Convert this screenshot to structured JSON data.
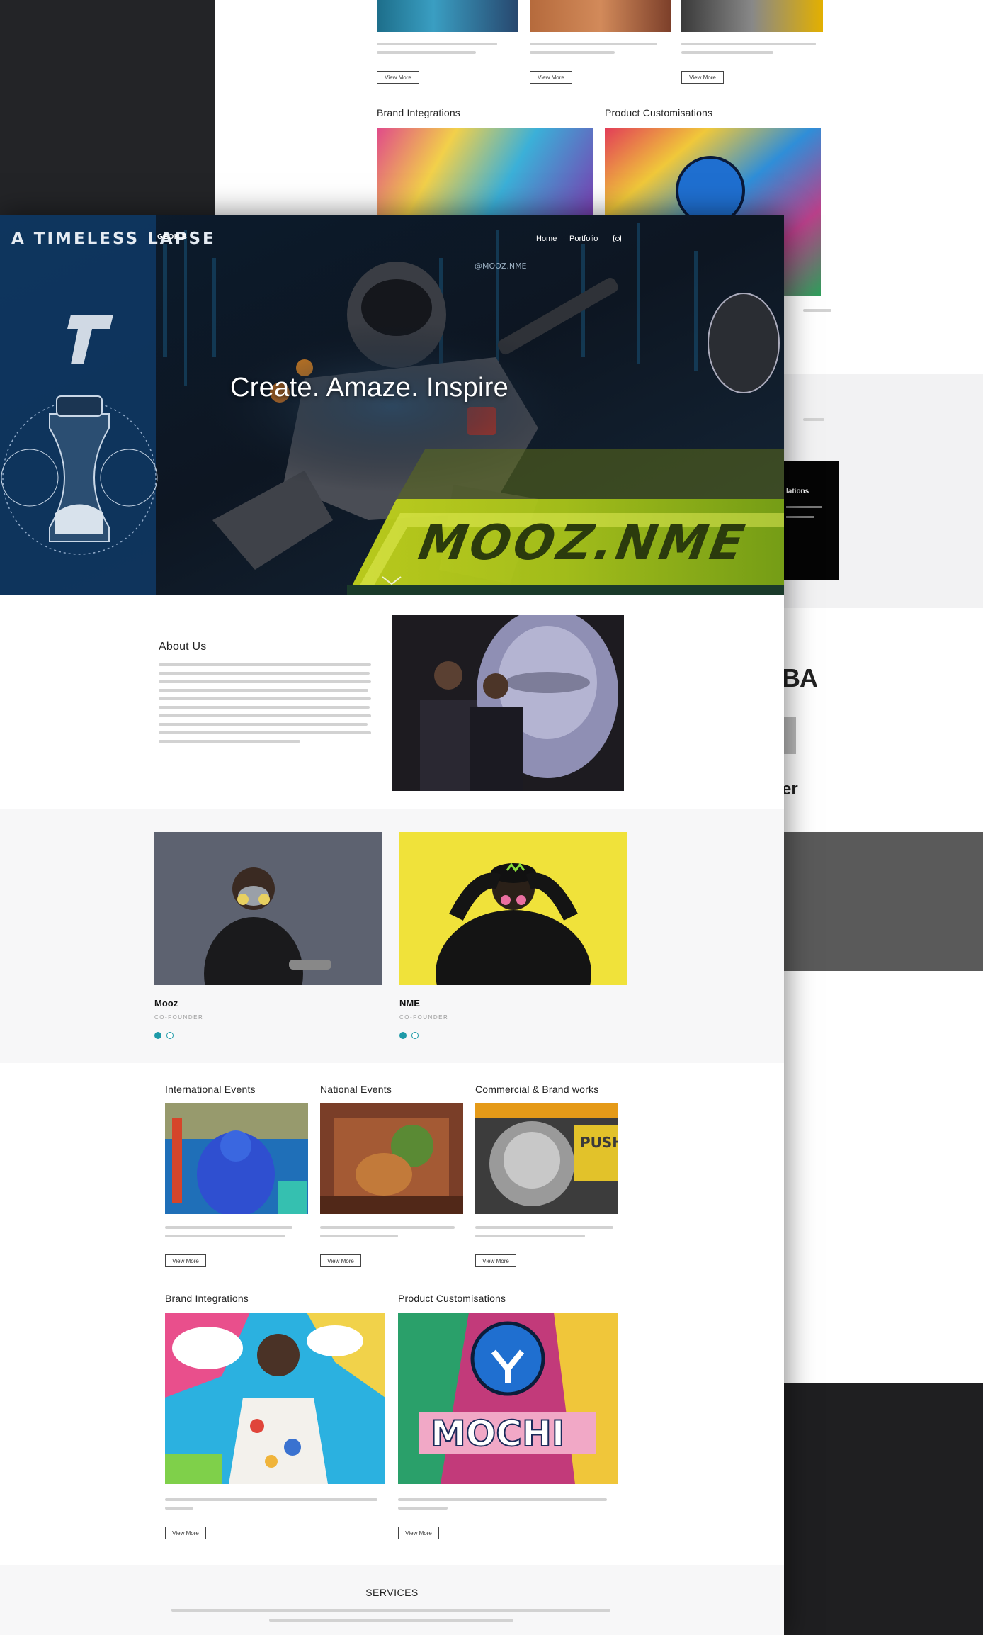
{
  "hero": {
    "brand": "GEOK B",
    "nav": {
      "home": "Home",
      "portfolio": "Portfolio",
      "instagram_icon": "instagram-icon"
    },
    "headline": "Create. Amaze. Inspire",
    "mural_text_left": "A TIMELESS LAPSE",
    "mural_text_right": "MOOZ.NME",
    "mural_tag": "@MOOZ.NME"
  },
  "about": {
    "title": "About Us"
  },
  "artists": [
    {
      "name": "Mooz",
      "role": "CO-FOUNDER"
    },
    {
      "name": "NME",
      "role": "CO-FOUNDER"
    }
  ],
  "categories_row1": [
    {
      "title": "International Events",
      "button": "View More"
    },
    {
      "title": "National Events",
      "button": "View More"
    },
    {
      "title": "Commercial & Brand works",
      "button": "View More"
    }
  ],
  "categories_row2": [
    {
      "title": "Brand Integrations",
      "button": "View More"
    },
    {
      "title": "Product Customisations",
      "button": "View More"
    }
  ],
  "commercial_art_text": "PUSH YOUR",
  "product_art_text": "MOCHI",
  "services": {
    "title": "SERVICES"
  },
  "background_page": {
    "brand_integrations": "Brand Integrations",
    "product_customisations": "Product Customisations",
    "buttons": [
      "View More",
      "View More",
      "View More"
    ],
    "dark_card_title": "lations",
    "partial_logo": "BA",
    "partial_word": "er"
  },
  "colors": {
    "page_bg": "#232427",
    "accent_teal": "#1e9aa8",
    "hero_dark": "#0d1620",
    "gray_band": "#f7f7f8",
    "dark_band": "#5a5a5a"
  }
}
